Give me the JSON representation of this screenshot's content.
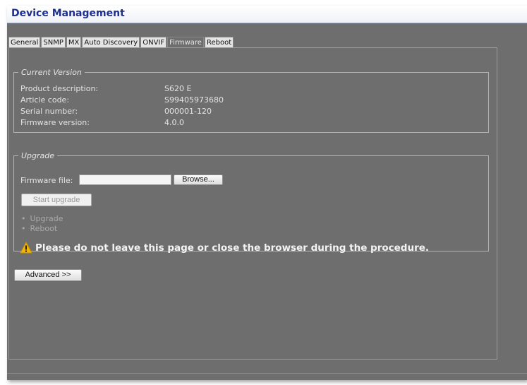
{
  "window": {
    "title": "Device Management"
  },
  "tabs": [
    {
      "label": "General"
    },
    {
      "label": "SNMP"
    },
    {
      "label": "MX"
    },
    {
      "label": "Auto Discovery"
    },
    {
      "label": "ONVIF"
    },
    {
      "label": "Firmware",
      "active": true
    },
    {
      "label": "Reboot"
    }
  ],
  "current_version": {
    "legend": "Current Version",
    "rows": [
      {
        "label": "Product description:",
        "value": "S620 E"
      },
      {
        "label": "Article code:",
        "value": "S99405973680"
      },
      {
        "label": "Serial number:",
        "value": "000001-120"
      },
      {
        "label": "Firmware version:",
        "value": "4.0.0"
      }
    ]
  },
  "upgrade": {
    "legend": "Upgrade",
    "file_label": "Firmware file:",
    "file_value": "",
    "browse_label": "Browse...",
    "start_label": "Start upgrade",
    "steps": [
      "Upgrade",
      "Reboot"
    ],
    "warning_icon": "warning-triangle-icon",
    "warning": "Please do not leave this page or close the browser during the procedure."
  },
  "advanced_label": "Advanced >>",
  "colors": {
    "background": "#6e6e6e",
    "title": "#1d2e8c",
    "warning_icon": "#f2b705"
  }
}
